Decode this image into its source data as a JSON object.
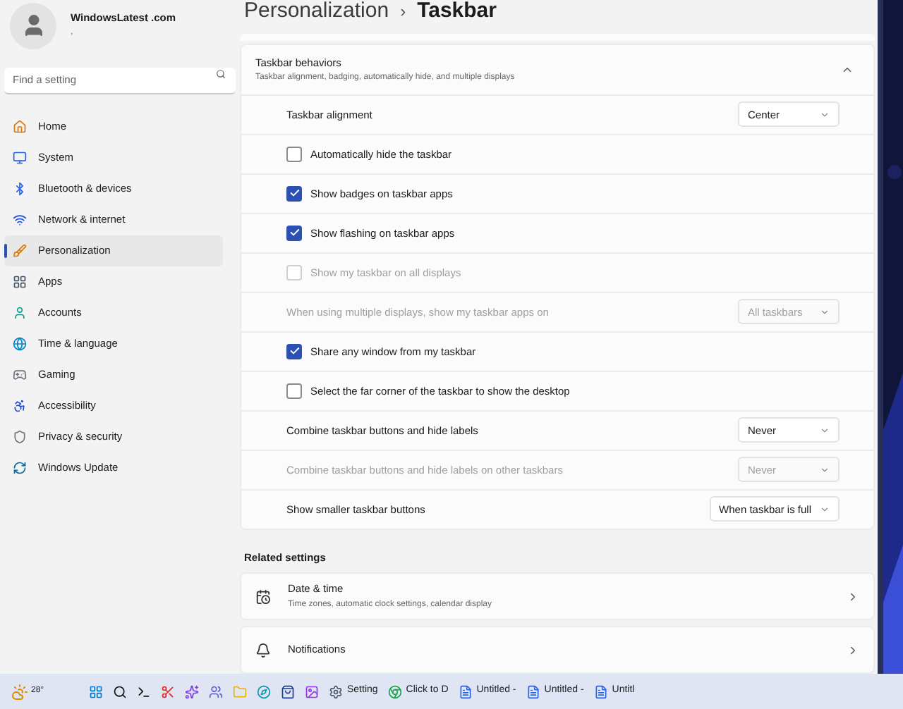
{
  "account": {
    "name": "WindowsLatest .com",
    "subtitle": ","
  },
  "search": {
    "placeholder": "Find a setting"
  },
  "sidebar": {
    "items": [
      {
        "label": "Home",
        "selected": false
      },
      {
        "label": "System",
        "selected": false
      },
      {
        "label": "Bluetooth & devices",
        "selected": false
      },
      {
        "label": "Network & internet",
        "selected": false
      },
      {
        "label": "Personalization",
        "selected": true
      },
      {
        "label": "Apps",
        "selected": false
      },
      {
        "label": "Accounts",
        "selected": false
      },
      {
        "label": "Time & language",
        "selected": false
      },
      {
        "label": "Gaming",
        "selected": false
      },
      {
        "label": "Accessibility",
        "selected": false
      },
      {
        "label": "Privacy & security",
        "selected": false
      },
      {
        "label": "Windows Update",
        "selected": false
      }
    ]
  },
  "breadcrumb": {
    "parent": "Personalization",
    "separator": "›",
    "current": "Taskbar"
  },
  "section": {
    "title": "Taskbar behaviors",
    "subtitle": "Taskbar alignment, badging, automatically hide, and multiple displays",
    "expanded": true,
    "rows": [
      {
        "kind": "dropdown",
        "label": "Taskbar alignment",
        "value": "Center",
        "disabled": false
      },
      {
        "kind": "checkbox",
        "label": "Automatically hide the taskbar",
        "checked": false,
        "disabled": false
      },
      {
        "kind": "checkbox",
        "label": "Show badges on taskbar apps",
        "checked": true,
        "disabled": false
      },
      {
        "kind": "checkbox",
        "label": "Show flashing on taskbar apps",
        "checked": true,
        "disabled": false
      },
      {
        "kind": "checkbox",
        "label": "Show my taskbar on all displays",
        "checked": false,
        "disabled": true
      },
      {
        "kind": "dropdown",
        "label": "When using multiple displays, show my taskbar apps on",
        "value": "All taskbars",
        "disabled": true
      },
      {
        "kind": "checkbox",
        "label": "Share any window from my taskbar",
        "checked": true,
        "disabled": false
      },
      {
        "kind": "checkbox",
        "label": "Select the far corner of the taskbar to show the desktop",
        "checked": false,
        "disabled": false
      },
      {
        "kind": "dropdown",
        "label": "Combine taskbar buttons and hide labels",
        "value": "Never",
        "disabled": false
      },
      {
        "kind": "dropdown",
        "label": "Combine taskbar buttons and hide labels on other taskbars",
        "value": "Never",
        "disabled": true
      },
      {
        "kind": "dropdown",
        "label": "Show smaller taskbar buttons",
        "value": "When taskbar is full",
        "disabled": false
      }
    ]
  },
  "related": {
    "title": "Related settings",
    "items": [
      {
        "title": "Date & time",
        "subtitle": "Time zones, automatic clock settings, calendar display"
      },
      {
        "title": "Notifications"
      }
    ]
  },
  "taskbar": {
    "weather": "28°",
    "windows": [
      {
        "label": "Setting"
      },
      {
        "label": "Click to D"
      },
      {
        "label": "Untitled -"
      },
      {
        "label": "Untitled -"
      },
      {
        "label": "Untitl"
      }
    ]
  }
}
